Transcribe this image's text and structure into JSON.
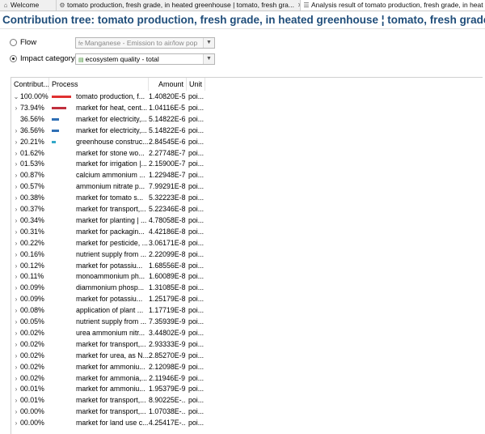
{
  "tabs": [
    {
      "label": "Welcome",
      "icon": "welcome-icon"
    },
    {
      "label": "tomato production, fresh grade, in heated greenhouse | tomato, fresh gra...",
      "icon": "process-icon",
      "close": "✕"
    },
    {
      "label": "Analysis result of tomato production, fresh grade, in heat",
      "icon": "analysis-icon"
    }
  ],
  "page_title": "Contribution tree: tomato production, fresh grade, in heated greenhouse ¦ tomato, fresh grade ¦ Cutoff, U (",
  "flow": {
    "label": "Flow",
    "value": "Manganese - Emission to air/low pop",
    "icon": "fe"
  },
  "impact": {
    "label": "Impact category",
    "value": "ecosystem quality - total",
    "selected": true
  },
  "accent_color": "#1f4d7a",
  "columns": [
    "Contribut...",
    "Process",
    "Amount",
    "Unit"
  ],
  "rows": [
    {
      "expand": "⌄",
      "contrib": "100.00%",
      "bar": 1.0,
      "bar_color": "#e03030",
      "process": "tomato production, f...",
      "amount": "1.40820E-5",
      "unit": "poi..."
    },
    {
      "expand": "›",
      "contrib": "73.94%",
      "bar": 0.7394,
      "bar_color": "#c0303e",
      "process": "market for heat, cent...",
      "amount": "1.04116E-5",
      "unit": "poi..."
    },
    {
      "expand": "",
      "contrib": "36.56%",
      "bar": 0.3656,
      "bar_color": "#2f6fb5",
      "process": "market for electricity,...",
      "amount": "5.14822E-6",
      "unit": "poi..."
    },
    {
      "expand": "›",
      "contrib": "36.56%",
      "bar": 0.3656,
      "bar_color": "#2f6fb5",
      "process": "market for electricity,...",
      "amount": "5.14822E-6",
      "unit": "poi..."
    },
    {
      "expand": "›",
      "contrib": "20.21%",
      "bar": 0.2021,
      "bar_color": "#32a8c8",
      "process": "greenhouse construc...",
      "amount": "2.84545E-6",
      "unit": "poi..."
    },
    {
      "expand": "›",
      "contrib": "01.62%",
      "bar": 0,
      "bar_color": "",
      "process": "market for stone wo...",
      "amount": "2.27748E-7",
      "unit": "poi..."
    },
    {
      "expand": "›",
      "contrib": "01.53%",
      "bar": 0,
      "bar_color": "",
      "process": "market for irrigation |...",
      "amount": "2.15900E-7",
      "unit": "poi..."
    },
    {
      "expand": "›",
      "contrib": "00.87%",
      "bar": 0,
      "bar_color": "",
      "process": "calcium ammonium ...",
      "amount": "1.22948E-7",
      "unit": "poi..."
    },
    {
      "expand": "›",
      "contrib": "00.57%",
      "bar": 0,
      "bar_color": "",
      "process": "ammonium nitrate p...",
      "amount": "7.99291E-8",
      "unit": "poi..."
    },
    {
      "expand": "›",
      "contrib": "00.38%",
      "bar": 0,
      "bar_color": "",
      "process": "market for tomato s...",
      "amount": "5.32223E-8",
      "unit": "poi..."
    },
    {
      "expand": "›",
      "contrib": "00.37%",
      "bar": 0,
      "bar_color": "",
      "process": "market for transport,...",
      "amount": "5.22346E-8",
      "unit": "poi..."
    },
    {
      "expand": "›",
      "contrib": "00.34%",
      "bar": 0,
      "bar_color": "",
      "process": "market for planting | ...",
      "amount": "4.78058E-8",
      "unit": "poi..."
    },
    {
      "expand": "›",
      "contrib": "00.31%",
      "bar": 0,
      "bar_color": "",
      "process": "market for packagin...",
      "amount": "4.42186E-8",
      "unit": "poi..."
    },
    {
      "expand": "›",
      "contrib": "00.22%",
      "bar": 0,
      "bar_color": "",
      "process": "market for pesticide, ...",
      "amount": "3.06171E-8",
      "unit": "poi..."
    },
    {
      "expand": "›",
      "contrib": "00.16%",
      "bar": 0,
      "bar_color": "",
      "process": "nutrient supply from ...",
      "amount": "2.22099E-8",
      "unit": "poi..."
    },
    {
      "expand": "›",
      "contrib": "00.12%",
      "bar": 0,
      "bar_color": "",
      "process": "market for potassiu...",
      "amount": "1.68556E-8",
      "unit": "poi..."
    },
    {
      "expand": "›",
      "contrib": "00.11%",
      "bar": 0,
      "bar_color": "",
      "process": "monoammonium ph...",
      "amount": "1.60089E-8",
      "unit": "poi..."
    },
    {
      "expand": "›",
      "contrib": "00.09%",
      "bar": 0,
      "bar_color": "",
      "process": "diammonium phosp...",
      "amount": "1.31085E-8",
      "unit": "poi..."
    },
    {
      "expand": "›",
      "contrib": "00.09%",
      "bar": 0,
      "bar_color": "",
      "process": "market for potassiu...",
      "amount": "1.25179E-8",
      "unit": "poi..."
    },
    {
      "expand": "›",
      "contrib": "00.08%",
      "bar": 0,
      "bar_color": "",
      "process": "application of plant ...",
      "amount": "1.17719E-8",
      "unit": "poi..."
    },
    {
      "expand": "›",
      "contrib": "00.05%",
      "bar": 0,
      "bar_color": "",
      "process": "nutrient supply from ...",
      "amount": "7.35939E-9",
      "unit": "poi..."
    },
    {
      "expand": "›",
      "contrib": "00.02%",
      "bar": 0,
      "bar_color": "",
      "process": "urea ammonium nitr...",
      "amount": "3.44802E-9",
      "unit": "poi..."
    },
    {
      "expand": "›",
      "contrib": "00.02%",
      "bar": 0,
      "bar_color": "",
      "process": "market for transport,...",
      "amount": "2.93333E-9",
      "unit": "poi..."
    },
    {
      "expand": "›",
      "contrib": "00.02%",
      "bar": 0,
      "bar_color": "",
      "process": "market for urea, as N...",
      "amount": "2.85270E-9",
      "unit": "poi..."
    },
    {
      "expand": "›",
      "contrib": "00.02%",
      "bar": 0,
      "bar_color": "",
      "process": "market for ammoniu...",
      "amount": "2.12098E-9",
      "unit": "poi..."
    },
    {
      "expand": "›",
      "contrib": "00.02%",
      "bar": 0,
      "bar_color": "",
      "process": "market for ammonia,...",
      "amount": "2.11946E-9",
      "unit": "poi..."
    },
    {
      "expand": "›",
      "contrib": "00.01%",
      "bar": 0,
      "bar_color": "",
      "process": "market for ammoniu...",
      "amount": "1.95379E-9",
      "unit": "poi..."
    },
    {
      "expand": "›",
      "contrib": "00.01%",
      "bar": 0,
      "bar_color": "",
      "process": "market for transport,...",
      "amount": "8.90225E-...",
      "unit": "poi..."
    },
    {
      "expand": "›",
      "contrib": "00.00%",
      "bar": 0,
      "bar_color": "",
      "process": "market for transport,...",
      "amount": "1.07038E-...",
      "unit": "poi..."
    },
    {
      "expand": "›",
      "contrib": "00.00%",
      "bar": 0,
      "bar_color": "",
      "process": "market for land use c...",
      "amount": "4.25417E-...",
      "unit": "poi..."
    }
  ]
}
